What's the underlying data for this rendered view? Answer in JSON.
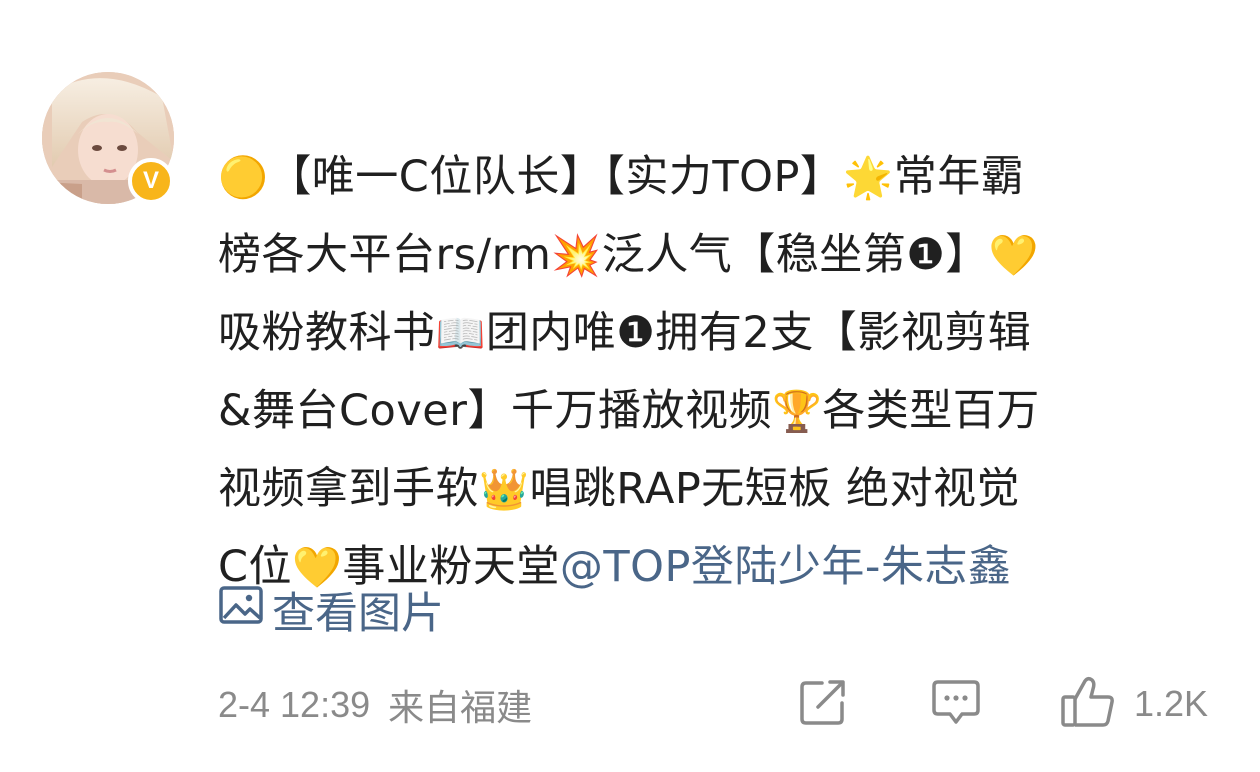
{
  "avatar": {
    "verified_badge": "V"
  },
  "post": {
    "lines": [
      [
        {
          "t": "emoji",
          "v": "🟡"
        },
        {
          "t": "text",
          "v": "【唯一C位队长】【实力TOP】"
        },
        {
          "t": "emoji",
          "v": "🌟"
        },
        {
          "t": "text",
          "v": "常年霸"
        }
      ],
      [
        {
          "t": "text",
          "v": "榜各大平台rs/rm"
        },
        {
          "t": "emoji",
          "v": "💥"
        },
        {
          "t": "text",
          "v": "泛人气【稳坐第❶】"
        },
        {
          "t": "emoji",
          "v": "💛"
        }
      ],
      [
        {
          "t": "text",
          "v": "吸粉教科书"
        },
        {
          "t": "emoji",
          "v": "📖"
        },
        {
          "t": "text",
          "v": "团内唯❶拥有2支【影视剪辑"
        }
      ],
      [
        {
          "t": "text",
          "v": "&舞台Cover】千万播放视频"
        },
        {
          "t": "emoji",
          "v": "🏆"
        },
        {
          "t": "text",
          "v": "各类型百万"
        }
      ],
      [
        {
          "t": "text",
          "v": "视频拿到手软"
        },
        {
          "t": "emoji",
          "v": "👑"
        },
        {
          "t": "text",
          "v": "唱跳RAP无短板 绝对视觉"
        }
      ],
      [
        {
          "t": "text",
          "v": "C位"
        },
        {
          "t": "emoji",
          "v": "💛"
        },
        {
          "t": "text",
          "v": "事业粉天堂"
        },
        {
          "t": "mention",
          "v": "@TOP登陆少年-朱志鑫"
        }
      ]
    ],
    "view_images_label": "查看图片",
    "view_images_icon": "image-icon"
  },
  "meta": {
    "time": "2-4 12:39",
    "source": "来自福建"
  },
  "actions": {
    "repost_icon": "share-edit-icon",
    "comment_icon": "comment-icon",
    "like_icon": "thumbs-up-icon",
    "like_count": "1.2K"
  },
  "colors": {
    "text": "#202020",
    "link": "#4a6688",
    "meta": "#8a8a8a",
    "badge": "#f8b51a"
  }
}
